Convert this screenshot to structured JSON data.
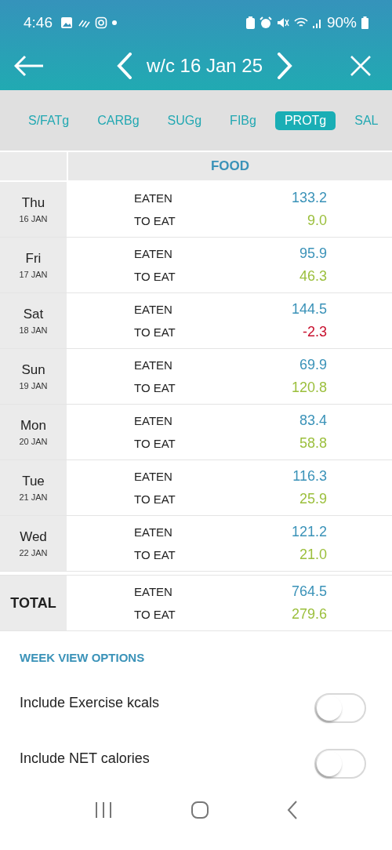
{
  "status_bar": {
    "time": "4:46",
    "battery": "90%"
  },
  "header": {
    "title": "w/c 16 Jan 25"
  },
  "tabs": [
    {
      "label": "S/FATg",
      "selected": false
    },
    {
      "label": "CARBg",
      "selected": false
    },
    {
      "label": "SUGg",
      "selected": false
    },
    {
      "label": "FIBg",
      "selected": false
    },
    {
      "label": "PROTg",
      "selected": true
    },
    {
      "label": "SAL",
      "selected": false
    }
  ],
  "table": {
    "column_header": "FOOD",
    "rows": [
      {
        "day": "Thu",
        "date": "16 JAN",
        "eaten_label": "EATEN",
        "eaten": "133.2",
        "to_eat_label": "TO EAT",
        "to_eat": "9.0",
        "over_target": false
      },
      {
        "day": "Fri",
        "date": "17 JAN",
        "eaten_label": "EATEN",
        "eaten": "95.9",
        "to_eat_label": "TO EAT",
        "to_eat": "46.3",
        "over_target": false
      },
      {
        "day": "Sat",
        "date": "18 JAN",
        "eaten_label": "EATEN",
        "eaten": "144.5",
        "to_eat_label": "TO EAT",
        "to_eat": "-2.3",
        "over_target": true
      },
      {
        "day": "Sun",
        "date": "19 JAN",
        "eaten_label": "EATEN",
        "eaten": "69.9",
        "to_eat_label": "TO EAT",
        "to_eat": "120.8",
        "over_target": false
      },
      {
        "day": "Mon",
        "date": "20 JAN",
        "eaten_label": "EATEN",
        "eaten": "83.4",
        "to_eat_label": "TO EAT",
        "to_eat": "58.8",
        "over_target": false
      },
      {
        "day": "Tue",
        "date": "21 JAN",
        "eaten_label": "EATEN",
        "eaten": "116.3",
        "to_eat_label": "TO EAT",
        "to_eat": "25.9",
        "over_target": false
      },
      {
        "day": "Wed",
        "date": "22 JAN",
        "eaten_label": "EATEN",
        "eaten": "121.2",
        "to_eat_label": "TO EAT",
        "to_eat": "21.0",
        "over_target": false
      }
    ],
    "total": {
      "label": "TOTAL",
      "eaten_label": "EATEN",
      "eaten": "764.5",
      "to_eat_label": "TO EAT",
      "to_eat": "279.6",
      "over_target": false
    }
  },
  "options": {
    "heading": "WEEK VIEW OPTIONS",
    "items": [
      {
        "label": "Include Exercise kcals",
        "on": false
      },
      {
        "label": "Include NET calories",
        "on": false
      }
    ]
  }
}
